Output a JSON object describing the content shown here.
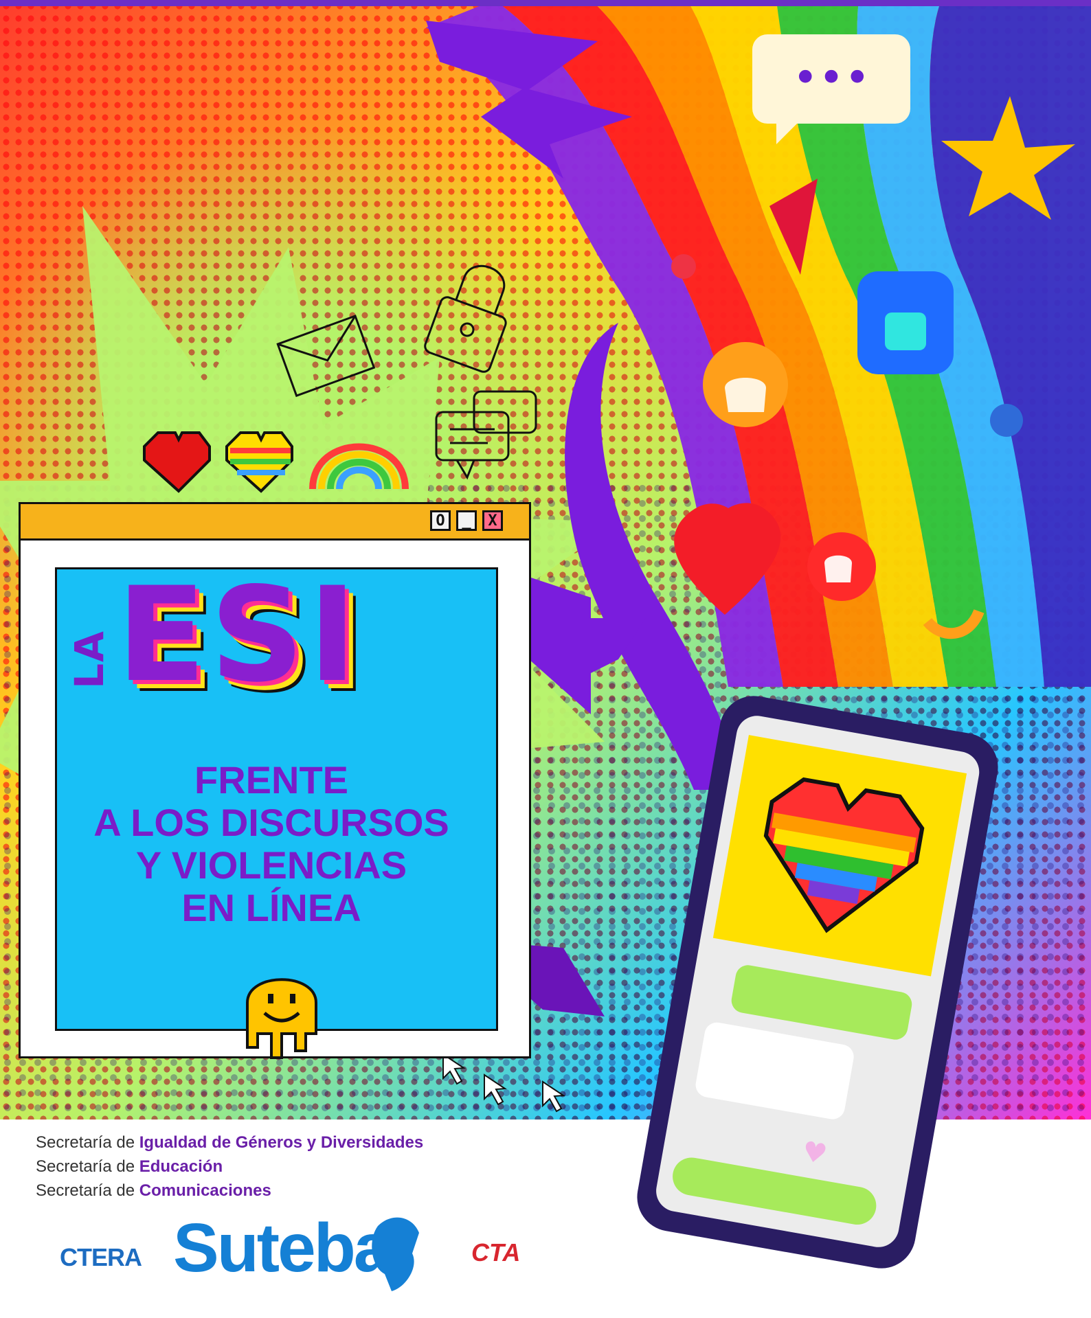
{
  "poster": {
    "prefix": "LA",
    "title": "ESI",
    "subtitle_lines": [
      "FRENTE",
      "A LOS DISCURSOS",
      "Y VIOLENCIAS",
      "EN LÍNEA"
    ]
  },
  "window_controls": {
    "maximize": "O",
    "minimize": "_",
    "close": "X"
  },
  "chat_bubble_icon": "•••",
  "credits": [
    {
      "prefix": "Secretaría de ",
      "emphasis": "Igualdad de Géneros y Diversidades"
    },
    {
      "prefix": "Secretaría de ",
      "emphasis": "Educación"
    },
    {
      "prefix": "Secretaría de ",
      "emphasis": "Comunicaciones"
    }
  ],
  "logos": {
    "ctera": "CTERA",
    "suteba": "Suteba",
    "cta": "CTA"
  },
  "colors": {
    "purple": "#7a1dc8",
    "panel_blue": "#18c0f6",
    "titlebar_orange": "#f7b21b",
    "lime": "#b6f26b"
  },
  "icons": [
    "envelope-icon",
    "padlock-icon",
    "chat-icon",
    "pixel-heart-icon",
    "pixel-rainbow-heart-icon",
    "pixel-rainbow-icon",
    "smiley-icon",
    "cursor-icon",
    "thumbs-up-icon",
    "star-icon",
    "heart-icon"
  ]
}
